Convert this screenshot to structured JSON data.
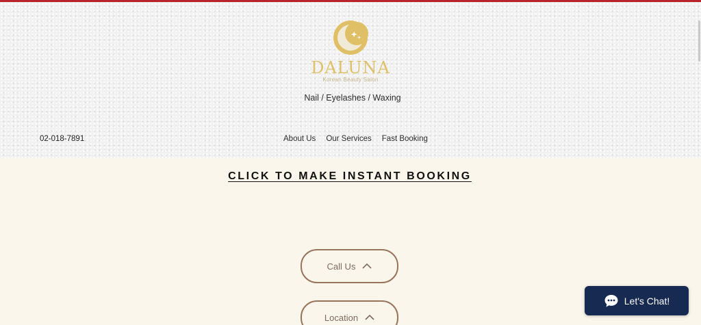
{
  "header": {
    "brand_name": "DALUNA",
    "brand_subtitle": "Korean Beauty Salon",
    "tagline": "Nail / Eyelashes / Waxing",
    "phone": "02-018-7891",
    "nav": [
      {
        "label": "About Us"
      },
      {
        "label": "Our Services"
      },
      {
        "label": "Fast Booking"
      }
    ]
  },
  "main": {
    "booking_link": "CLICK TO MAKE INSTANT BOOKING",
    "buttons": {
      "call": "Call Us",
      "location": "Location"
    }
  },
  "chat": {
    "label": "Let's Chat!"
  },
  "colors": {
    "accent_border": "#b8242a",
    "brand_gold": "#e0c067",
    "page_background": "#faf6ec",
    "pill_border": "#98745a",
    "chat_background": "#172a51"
  },
  "icons": {
    "logo": "crescent-moon-stars-icon",
    "pill_chevron": "chevron-up-icon",
    "chat": "chat-bubble-icon"
  }
}
